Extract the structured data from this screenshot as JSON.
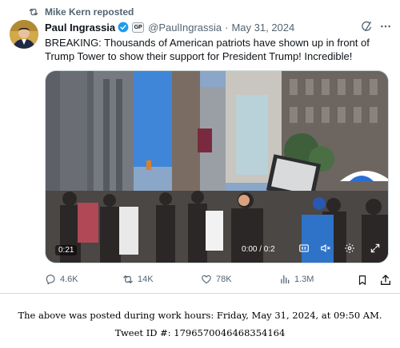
{
  "repost": {
    "label": "Mike Kern reposted"
  },
  "tweet": {
    "author_name": "Paul Ingrassia",
    "badge_label": "GP",
    "handle": "@PaulIngrassia",
    "separator": "·",
    "date": "May 31, 2024",
    "text": "BREAKING: Thousands of American patriots have shown up in front of Trump Tower to show their support for President Trump! Incredible!"
  },
  "video": {
    "elapsed": "0:21",
    "progress": "0:00 / 0:2"
  },
  "actions": {
    "replies": "4.6K",
    "reposts": "14K",
    "likes": "78K",
    "views": "1.3M"
  },
  "caption": {
    "line1": "The above was posted during work hours: Friday, May 31, 2024, at 09:50 AM.",
    "line2": "Tweet ID #: 1796570046468354164"
  },
  "colors": {
    "verified_blue": "#1d9bf0",
    "muted_gray": "#536471",
    "text_black": "#0f1419"
  },
  "icons": [
    "repost-icon",
    "verified-icon",
    "grok-icon",
    "more-icon",
    "cc-icon",
    "volume-icon",
    "gear-icon",
    "expand-icon",
    "reply-icon",
    "views-icon",
    "bookmark-icon",
    "share-icon"
  ]
}
